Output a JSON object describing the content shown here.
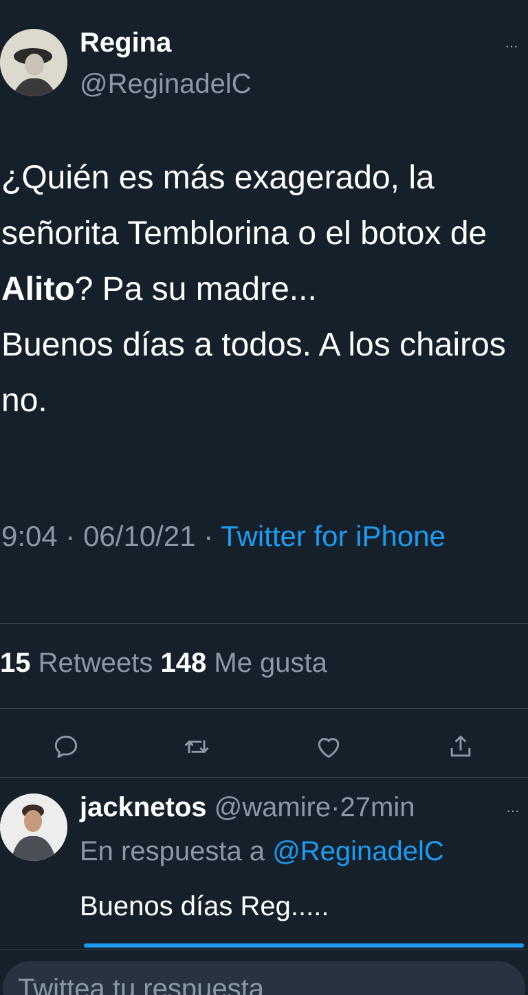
{
  "tweet": {
    "author_name": "Regina",
    "author_handle": "@ReginadelC",
    "text_before": "¿Quién es más exagerado, la señorita Temblorina o el botox de ",
    "text_bold": "Alito",
    "text_after_1": "? Pa su madre...",
    "text_line_2": "Buenos días a todos. A los chairos no.",
    "time": "9:04",
    "separator": " · ",
    "date": "06/10/21",
    "source": "Twitter for iPhone",
    "retweets_count": "15",
    "retweets_label": "Retweets",
    "likes_count": "148",
    "likes_label": "Me gusta",
    "more_label": "···"
  },
  "actions": [
    {
      "name": "reply-icon"
    },
    {
      "name": "retweet-icon"
    },
    {
      "name": "like-icon"
    },
    {
      "name": "share-icon"
    }
  ],
  "reply": {
    "author_name": "jacknetos",
    "author_handle": "@wamire",
    "separator": "·",
    "time_ago": "27min",
    "in_reply_prefix": "En respuesta a ",
    "in_reply_handle": "@ReginadelC",
    "text": "Buenos días Reg.....",
    "more_label": "···"
  },
  "composer": {
    "placeholder": "Twittea tu respuesta"
  },
  "colors": {
    "background": "#15202b",
    "accent": "#1d9bf0",
    "secondary_text": "#8b98a5"
  }
}
